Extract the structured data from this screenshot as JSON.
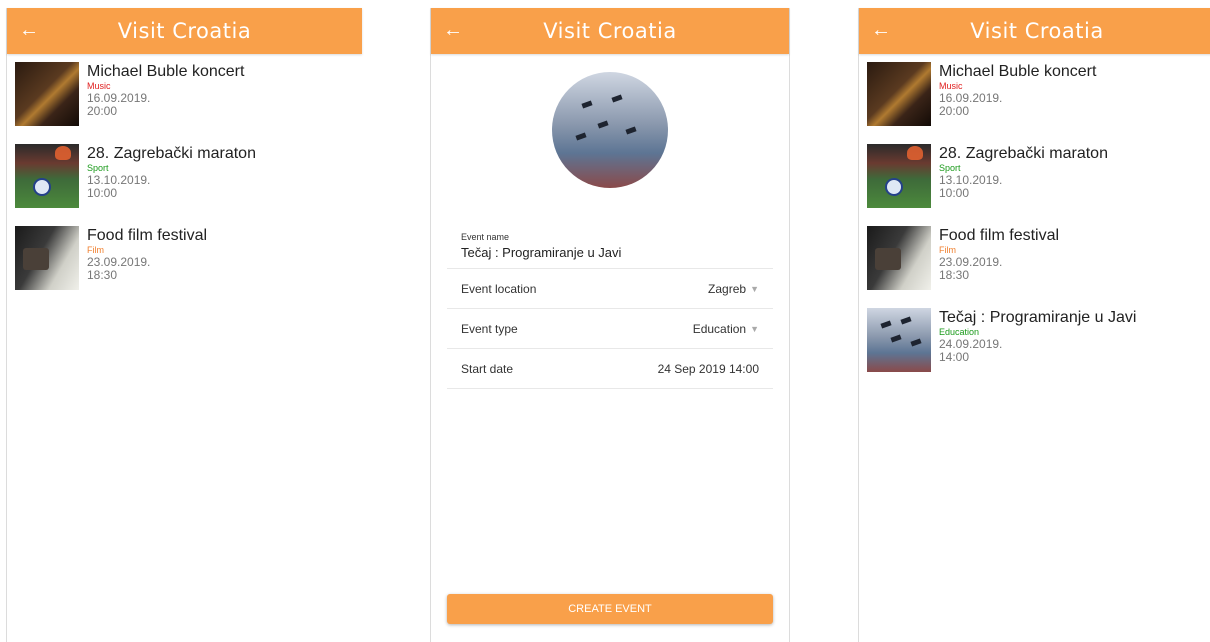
{
  "app": {
    "title": "Visit Croatia",
    "back_icon": "←"
  },
  "colors": {
    "accent": "#f9a04a",
    "music": "#e02020",
    "sport": "#1a9a1a",
    "film": "#f08030",
    "education": "#1a9a1a"
  },
  "list_before": [
    {
      "name": "Michael Buble koncert",
      "type": "Music",
      "date": "16.09.2019.",
      "time": "20:00"
    },
    {
      "name": "28. Zagrebački maraton",
      "type": "Sport",
      "date": "13.10.2019.",
      "time": "10:00"
    },
    {
      "name": "Food film festival",
      "type": "Film",
      "date": "23.09.2019.",
      "time": "18:30"
    }
  ],
  "form": {
    "event_name_label": "Event name",
    "event_name_value": "Tečaj : Programiranje u Javi",
    "location_label": "Event location",
    "location_value": "Zagreb",
    "type_label": "Event type",
    "type_value": "Education",
    "start_label": "Start date",
    "start_value": "24 Sep 2019 14:00",
    "create_button": "CREATE EVENT"
  },
  "list_after": [
    {
      "name": "Michael Buble koncert",
      "type": "Music",
      "date": "16.09.2019.",
      "time": "20:00"
    },
    {
      "name": "28. Zagrebački maraton",
      "type": "Sport",
      "date": "13.10.2019.",
      "time": "10:00"
    },
    {
      "name": "Food film festival",
      "type": "Film",
      "date": "23.09.2019.",
      "time": "18:30"
    },
    {
      "name": "Tečaj : Programiranje u Javi",
      "type": "Education",
      "date": "24.09.2019.",
      "time": "14:00"
    }
  ]
}
